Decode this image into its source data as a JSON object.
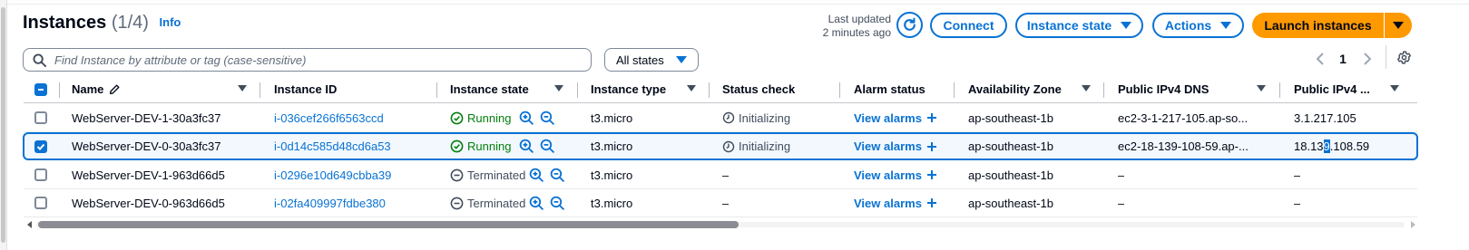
{
  "header": {
    "title": "Instances",
    "count": "(1/4)",
    "info_link": "Info",
    "last_updated_label": "Last updated",
    "last_updated_value": "2 minutes ago",
    "connect_label": "Connect",
    "instance_state_label": "Instance state",
    "actions_label": "Actions",
    "launch_label": "Launch instances"
  },
  "filter": {
    "search_placeholder": "Find Instance by attribute or tag (case-sensitive)",
    "states_value": "All states"
  },
  "pagination": {
    "current_page": "1",
    "prev_icon": "chevron-left-icon",
    "next_icon": "chevron-right-icon"
  },
  "columns": [
    "Name",
    "Instance ID",
    "Instance state",
    "Instance type",
    "Status check",
    "Alarm status",
    "Availability Zone",
    "Public IPv4 DNS",
    "Public IPv4 ..."
  ],
  "rows": [
    {
      "name": "WebServer-DEV-1-30a3fc37",
      "instance_id": "i-036cef266f6563ccd",
      "state": "Running",
      "type": "t3.micro",
      "status_check": "Initializing",
      "alarm": "View alarms",
      "az": "ap-southeast-1b",
      "dns": "ec2-3-1-217-105.ap-so...",
      "ip": "3.1.217.105",
      "selected": false
    },
    {
      "name": "WebServer-DEV-0-30a3fc37",
      "instance_id": "i-0d14c585d48cd6a53",
      "state": "Running",
      "type": "t3.micro",
      "status_check": "Initializing",
      "alarm": "View alarms",
      "az": "ap-southeast-1b",
      "dns": "ec2-18-139-108-59.ap-...",
      "ip": "18.139.108.59",
      "ip_pre": "18.13",
      "ip_hl": "9",
      "ip_post": ".108.59",
      "selected": true
    },
    {
      "name": "WebServer-DEV-1-963d66d5",
      "instance_id": "i-0296e10d649cbba39",
      "state": "Terminated",
      "type": "t3.micro",
      "status_check": "–",
      "alarm": "View alarms",
      "az": "ap-southeast-1b",
      "dns": "–",
      "ip": "–",
      "selected": false
    },
    {
      "name": "WebServer-DEV-0-963d66d5",
      "instance_id": "i-02fa409997fdbe380",
      "state": "Terminated",
      "type": "t3.micro",
      "status_check": "–",
      "alarm": "View alarms",
      "az": "ap-southeast-1b",
      "dns": "–",
      "ip": "–",
      "selected": false
    }
  ],
  "colors": {
    "link": "#0972d3",
    "running": "#037f0c",
    "launch": "#ff9900",
    "selected_row": "#f2f8fd"
  }
}
